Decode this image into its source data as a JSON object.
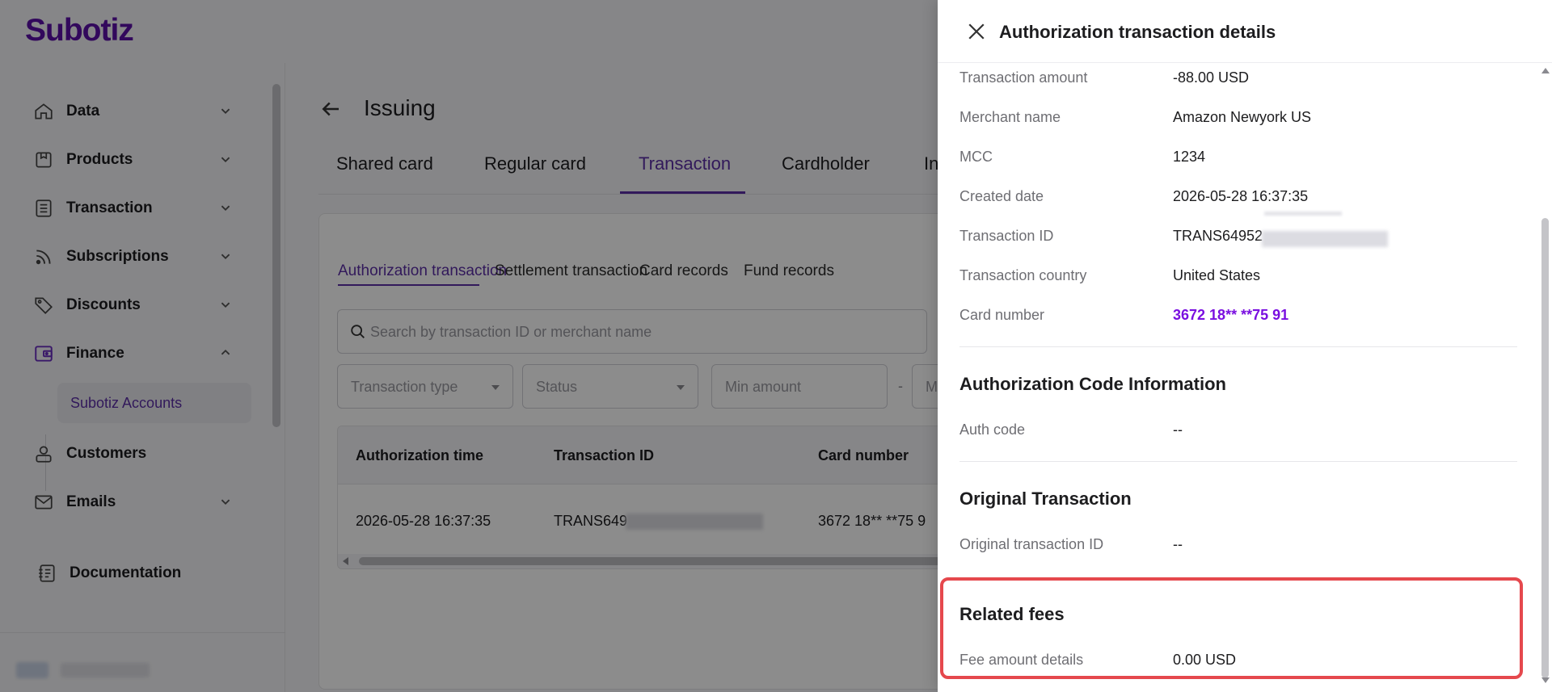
{
  "app": {
    "logo": "Subotiz"
  },
  "sidebar": {
    "items": [
      {
        "label": "Data",
        "icon": "home-icon"
      },
      {
        "label": "Products",
        "icon": "box-icon"
      },
      {
        "label": "Transaction",
        "icon": "list-icon"
      },
      {
        "label": "Subscriptions",
        "icon": "rss-icon"
      },
      {
        "label": "Discounts",
        "icon": "tag-icon"
      },
      {
        "label": "Finance",
        "icon": "wallet-icon",
        "expanded": true
      },
      {
        "label": "Customers",
        "icon": "user-icon"
      },
      {
        "label": "Emails",
        "icon": "mail-icon"
      },
      {
        "label": "Documentation",
        "icon": "doc-icon"
      }
    ],
    "finance_sub": "Subotiz Accounts"
  },
  "main": {
    "title": "Issuing",
    "tabs": [
      "Shared card",
      "Regular card",
      "Transaction",
      "Cardholder",
      "In"
    ],
    "active_tab": "Transaction",
    "subtabs": [
      "Authorization transaction",
      "Settlement transaction",
      "Card records",
      "Fund records"
    ],
    "active_subtab": "Authorization transaction",
    "search_placeholder": "Search by transaction ID or merchant name",
    "filters": {
      "transaction_type": "Transaction type",
      "status": "Status",
      "min_amount": "Min amount",
      "dash": "-",
      "max_amount": "M"
    },
    "table": {
      "columns": [
        "Authorization time",
        "Transaction ID",
        "Card number"
      ],
      "rows": [
        {
          "time": "2026-05-28 16:37:35",
          "id": "TRANS649",
          "card": "3672 18** **75 9"
        }
      ]
    }
  },
  "drawer": {
    "title": "Authorization transaction details",
    "details": [
      {
        "label": "Transaction amount",
        "value": "-88.00 USD"
      },
      {
        "label": "Merchant name",
        "value": "Amazon Newyork US"
      },
      {
        "label": "MCC",
        "value": "1234"
      },
      {
        "label": "Created date",
        "value": "2026-05-28 16:37:35"
      },
      {
        "label": "Transaction ID",
        "value": "TRANS64952"
      },
      {
        "label": "Transaction country",
        "value": "United States"
      },
      {
        "label": "Card number",
        "value": "3672 18** **75 91"
      }
    ],
    "auth_section": {
      "title": "Authorization Code Information",
      "label": "Auth code",
      "value": "--"
    },
    "original_section": {
      "title": "Original Transaction",
      "label": "Original transaction ID",
      "value": "--"
    },
    "fees_section": {
      "title": "Related fees",
      "label": "Fee amount details",
      "value": "0.00 USD"
    }
  },
  "colors": {
    "brand": "#5b0fa8",
    "accent": "#5b2ea6",
    "link": "#7a0fe0",
    "highlight": "#e5484d"
  }
}
